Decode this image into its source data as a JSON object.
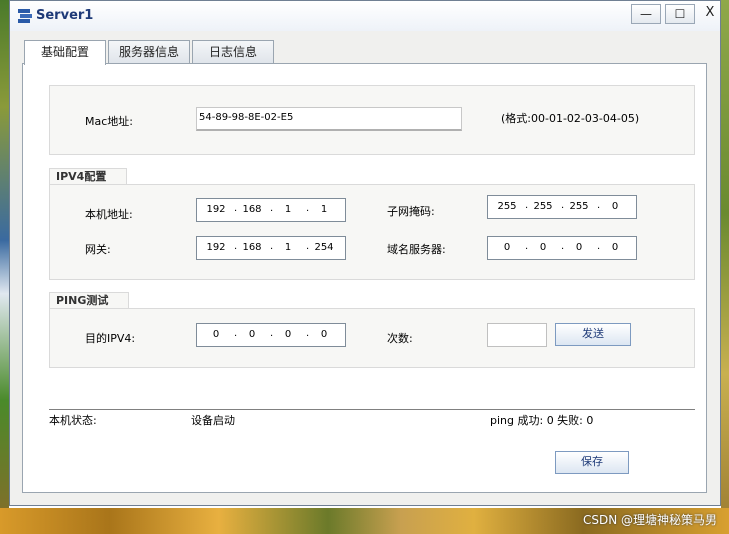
{
  "window": {
    "title": "Server1",
    "minimize": "—",
    "maximize": "☐",
    "close": "X"
  },
  "tabs": [
    {
      "label": "基础配置",
      "active": true
    },
    {
      "label": "服务器信息",
      "active": false
    },
    {
      "label": "日志信息",
      "active": false
    }
  ],
  "mac": {
    "label": "Mac地址:",
    "value": "54-89-98-8E-02-E5",
    "hint": "(格式:00-01-02-03-04-05)"
  },
  "ipv4": {
    "section_title": "IPV4配置",
    "local_label": "本机地址:",
    "local": [
      "192",
      "168",
      "1",
      "1"
    ],
    "mask_label": "子网掩码:",
    "mask": [
      "255",
      "255",
      "255",
      "0"
    ],
    "gateway_label": "网关:",
    "gateway": [
      "192",
      "168",
      "1",
      "254"
    ],
    "dns_label": "域名服务器:",
    "dns": [
      "0",
      "0",
      "0",
      "0"
    ]
  },
  "ping": {
    "section_title": "PING测试",
    "target_label": "目的IPV4:",
    "target": [
      "0",
      "0",
      "0",
      "0"
    ],
    "count_label": "次数:",
    "count_value": "",
    "send_button": "发送"
  },
  "status": {
    "label": "本机状态:",
    "value": "设备启动",
    "ping_result": "ping 成功: 0 失败: 0"
  },
  "save_button": "保存",
  "watermark": "CSDN @理塘神秘策马男"
}
